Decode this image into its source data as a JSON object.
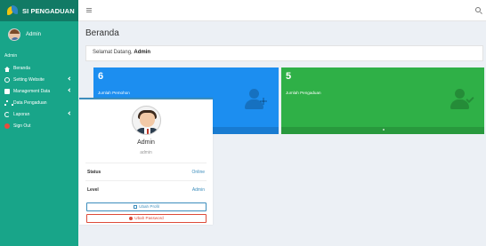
{
  "app": {
    "title": "SI PENGADUAN"
  },
  "sidebar": {
    "user_name": "Admin",
    "menu_header": "Admin",
    "items": [
      {
        "label": "Beranda",
        "icon": "home-icon",
        "has_submenu": false
      },
      {
        "label": "Setting Website",
        "icon": "cog-icon",
        "has_submenu": true
      },
      {
        "label": "Management Data",
        "icon": "book-icon",
        "has_submenu": true
      },
      {
        "label": "Data Pengaduan",
        "icon": "sitemap-icon",
        "has_submenu": false
      },
      {
        "label": "Laporan",
        "icon": "refresh-icon",
        "has_submenu": true
      },
      {
        "label": "Sign Out",
        "icon": "sign-out-icon",
        "has_submenu": false
      }
    ]
  },
  "header": {
    "menu_icon": "hamburger-icon",
    "search_icon": "search-icon"
  },
  "main": {
    "page_title": "Beranda",
    "welcome_text": "Selamat Datang,",
    "welcome_name": "Admin",
    "stats": [
      {
        "value": "6",
        "label": "Jumlah Pemohon",
        "color": "#1c8ef0",
        "icon": "user-plus-icon"
      },
      {
        "value": "5",
        "label": "Jumlah Pengaduan",
        "color": "#2fb047",
        "icon": "user-check-icon"
      }
    ],
    "profile": {
      "name": "Admin",
      "username": "admin",
      "rows": [
        {
          "key": "Status",
          "value": "Online"
        },
        {
          "key": "Level",
          "value": "Admin"
        }
      ],
      "edit_button": "Ubah Profil",
      "password_button": "Ubah Password"
    }
  },
  "colors": {
    "sidebar": "#18a589",
    "header_logo": "#117a65",
    "accent": "#3c8dbc",
    "danger": "#dd4b39"
  }
}
